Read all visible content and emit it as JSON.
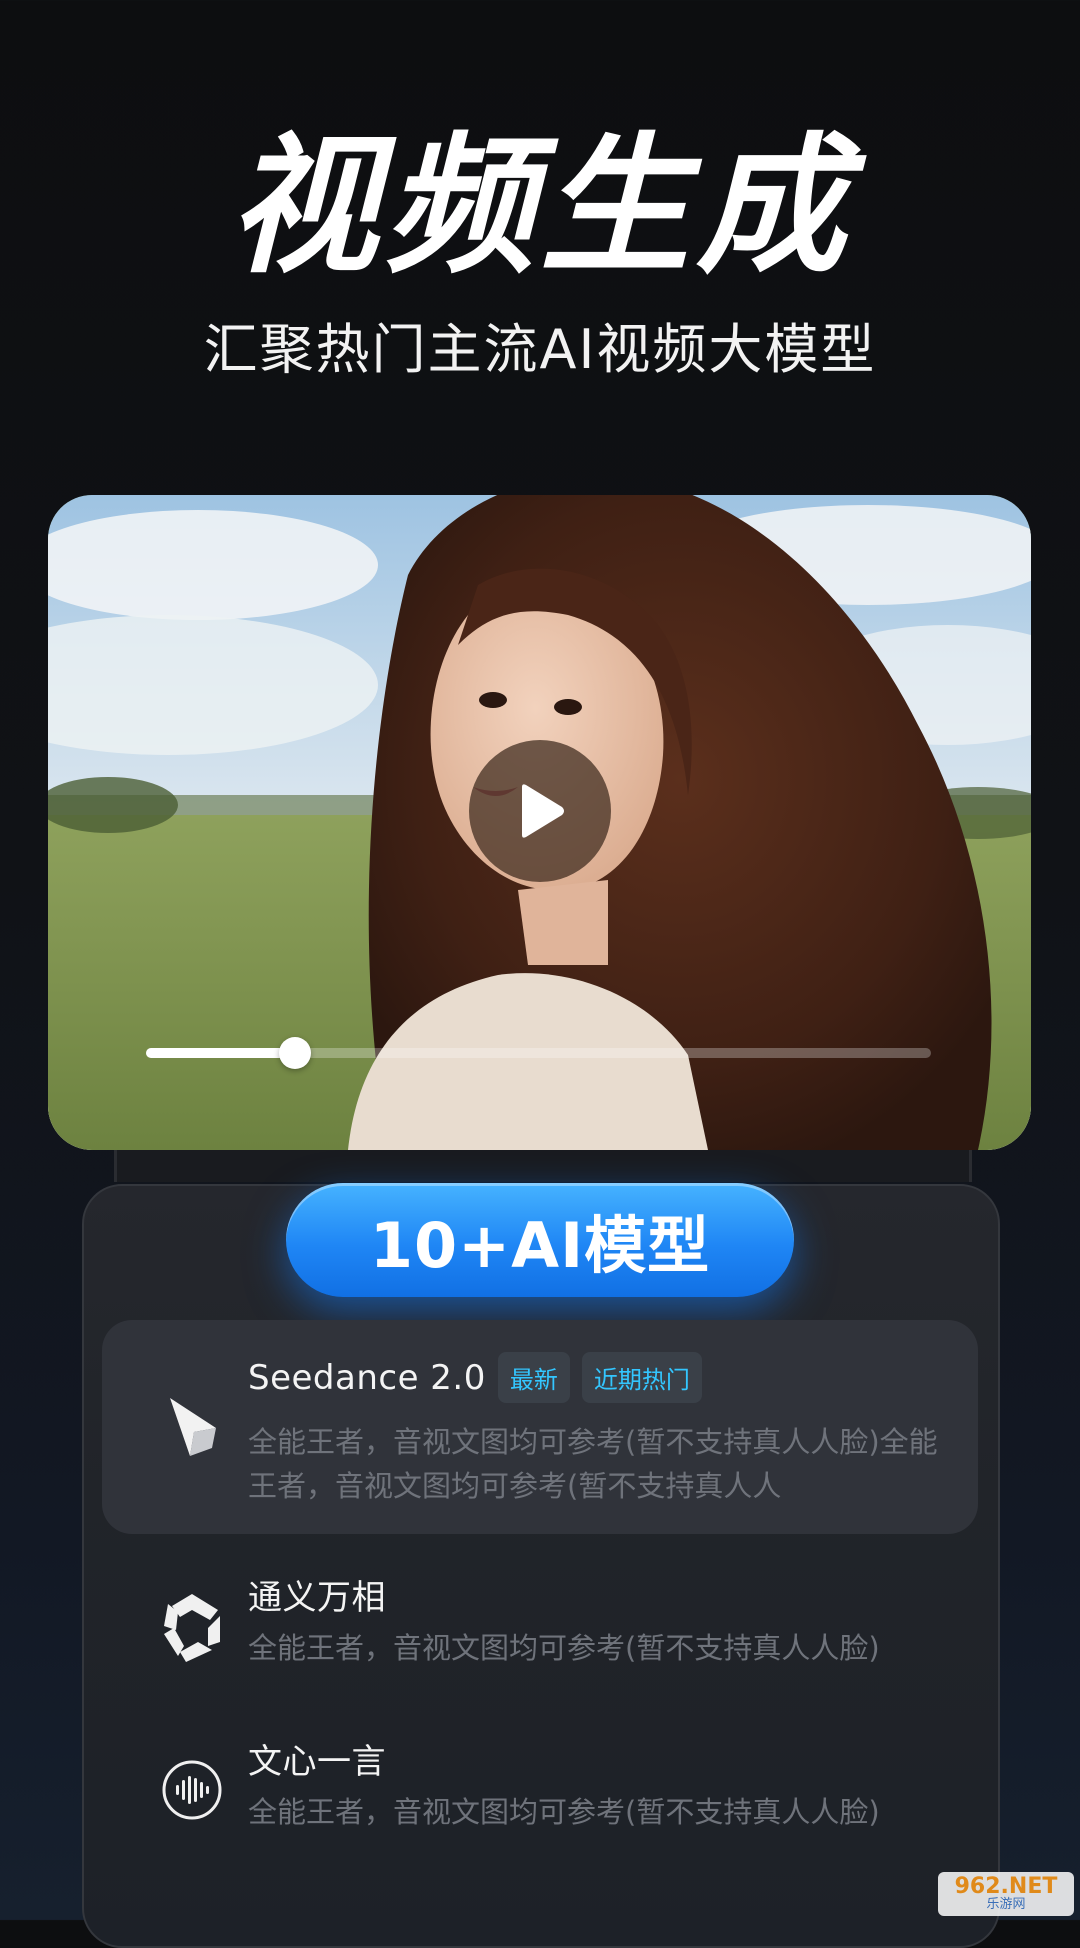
{
  "hero": {
    "title": "视频生成",
    "subtitle": "汇聚热门主流AI视频大模型"
  },
  "video": {
    "progress": 0.19,
    "play_icon": "play-icon"
  },
  "panel": {
    "models_label": "10+AI模型",
    "models": [
      {
        "name": "Seedance 2.0",
        "icon": "seedance-icon",
        "badges": [
          "最新",
          "近期热门"
        ],
        "description": "全能王者，音视文图均可参考(暂不支持真人人脸)全能王者，音视文图均可参考(暂不支持真人人"
      },
      {
        "name": "通义万相",
        "icon": "tongyi-icon",
        "description": "全能王者，音视文图均可参考(暂不支持真人人脸)"
      },
      {
        "name": "文心一言",
        "icon": "wenxin-icon",
        "description": "全能王者，音视文图均可参考(暂不支持真人人脸)"
      }
    ]
  },
  "colors": {
    "accent": "#1f86f5",
    "badge_text": "#33c6ff"
  },
  "watermark": {
    "top": "962.NET",
    "bottom": "乐游网"
  }
}
